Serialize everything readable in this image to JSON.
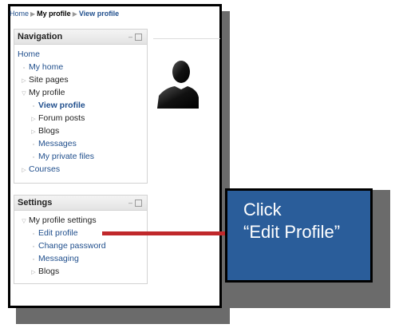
{
  "breadcrumb": [
    "Home",
    "My profile",
    "View profile"
  ],
  "navigation": {
    "title": "Navigation",
    "items": [
      {
        "label": "Home",
        "level": 0,
        "marker": "",
        "style": "lnk"
      },
      {
        "label": "My home",
        "level": 1,
        "marker": "square",
        "style": "lnk"
      },
      {
        "label": "Site pages",
        "level": 1,
        "marker": "tri-right",
        "style": "plain"
      },
      {
        "label": "My profile",
        "level": 1,
        "marker": "tri-down",
        "style": "plain"
      },
      {
        "label": "View profile",
        "level": 2,
        "marker": "square",
        "style": "bold"
      },
      {
        "label": "Forum posts",
        "level": 2,
        "marker": "tri-right",
        "style": "plain"
      },
      {
        "label": "Blogs",
        "level": 2,
        "marker": "tri-right",
        "style": "plain"
      },
      {
        "label": "Messages",
        "level": 2,
        "marker": "square",
        "style": "lnk"
      },
      {
        "label": "My private files",
        "level": 2,
        "marker": "square",
        "style": "lnk"
      },
      {
        "label": "Courses",
        "level": 1,
        "marker": "tri-right",
        "style": "lnk"
      }
    ]
  },
  "settings": {
    "title": "Settings",
    "items": [
      {
        "label": "My profile settings",
        "level": 1,
        "marker": "tri-down",
        "style": "plain"
      },
      {
        "label": "Edit profile",
        "level": 2,
        "marker": "square",
        "style": "lnk"
      },
      {
        "label": "Change password",
        "level": 2,
        "marker": "square",
        "style": "lnk"
      },
      {
        "label": "Messaging",
        "level": 2,
        "marker": "square",
        "style": "lnk"
      },
      {
        "label": "Blogs",
        "level": 2,
        "marker": "tri-right",
        "style": "plain"
      }
    ]
  },
  "block_controls": {
    "minus": "–"
  },
  "callout": {
    "line1": "Click",
    "line2": "“Edit Profile”"
  },
  "colors": {
    "callout_bg": "#2a5d9a",
    "arrow": "#c0282b",
    "link": "#1f4e8c"
  }
}
